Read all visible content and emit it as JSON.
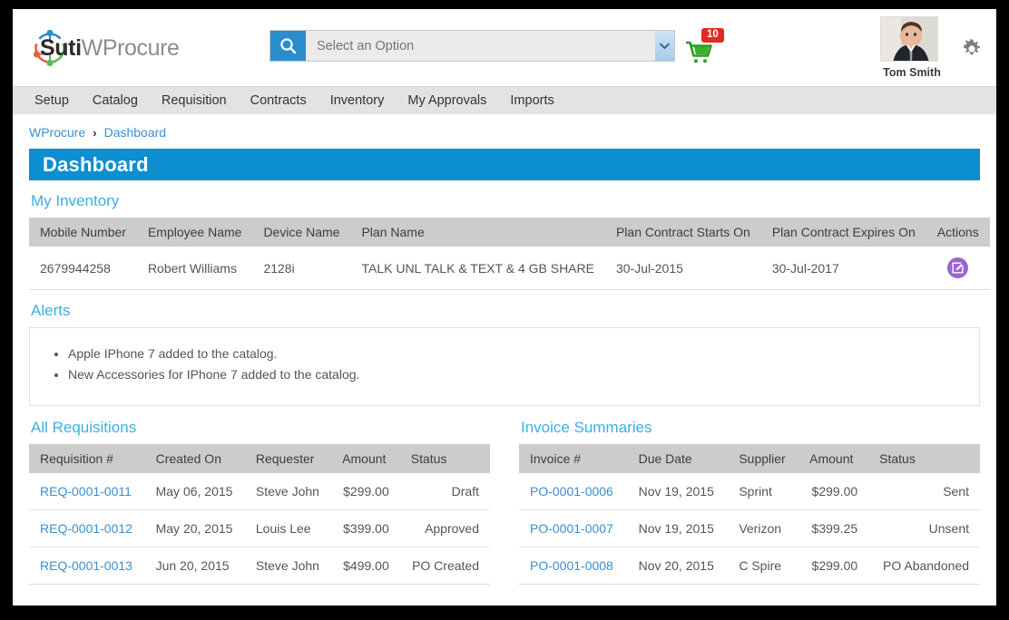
{
  "brand": {
    "name_bold": "Suti",
    "name_rest": "WProcure",
    "logo_colors": {
      "blue": "#2b8ccc",
      "orange": "#e8603c",
      "green": "#5cb85c"
    }
  },
  "header": {
    "search": {
      "placeholder": "Select an Option",
      "value": "",
      "icon": "search-icon",
      "dropdown_icon": "chevron-down-icon"
    },
    "cart": {
      "icon": "shopping-cart-icon",
      "badge_count": "10",
      "badge_color": "#e02b20"
    },
    "profile": {
      "name": "Tom Smith",
      "avatar_alt": "user-avatar"
    },
    "settings": {
      "icon": "gear-icon"
    }
  },
  "nav": {
    "items": [
      {
        "label": "Setup"
      },
      {
        "label": "Catalog"
      },
      {
        "label": "Requisition"
      },
      {
        "label": "Contracts"
      },
      {
        "label": "Inventory"
      },
      {
        "label": "My Approvals"
      },
      {
        "label": "Imports"
      }
    ]
  },
  "breadcrumb": {
    "root": "WProcure",
    "separator": "›",
    "current": "Dashboard"
  },
  "page": {
    "title": "Dashboard",
    "banner_color": "#0d8ed1"
  },
  "my_inventory": {
    "title": "My Inventory",
    "columns": [
      "Mobile Number",
      "Employee Name",
      "Device Name",
      "Plan Name",
      "Plan Contract Starts On",
      "Plan Contract Expires On",
      "Actions"
    ],
    "rows": [
      {
        "mobile_number": "2679944258",
        "employee_name": "Robert Williams",
        "device_name": "2128i",
        "plan_name": "TALK UNL TALK & TEXT & 4 GB SHARE",
        "starts_on": "30-Jul-2015",
        "expires_on": "30-Jul-2017",
        "action_icon": "edit-icon"
      }
    ]
  },
  "alerts": {
    "title": "Alerts",
    "items": [
      "Apple IPhone 7 added to the catalog.",
      "New Accessories for IPhone 7 added to the catalog."
    ]
  },
  "all_requisitions": {
    "title": "All Requisitions",
    "columns": [
      "Requisition #",
      "Created On",
      "Requester",
      "Amount",
      "Status"
    ],
    "rows": [
      {
        "requisition_no": "REQ-0001-0011",
        "created_on": "May 06, 2015",
        "requester": "Steve John",
        "amount": "$299.00",
        "status": "Draft",
        "status_color": "#e8251c"
      },
      {
        "requisition_no": "REQ-0001-0012",
        "created_on": "May 20, 2015",
        "requester": "Louis Lee",
        "amount": "$399.00",
        "status": "Approved",
        "status_color": "#e8251c"
      },
      {
        "requisition_no": "REQ-0001-0013",
        "created_on": "Jun 20, 2015",
        "requester": "Steve John",
        "amount": "$499.00",
        "status": "PO Created",
        "status_color": "#e8251c"
      }
    ]
  },
  "invoice_summaries": {
    "title": "Invoice Summaries",
    "columns": [
      "Invoice #",
      "Due Date",
      "Supplier",
      "Amount",
      "Status"
    ],
    "rows": [
      {
        "invoice_no": "PO-0001-0006",
        "due_date": "Nov 19, 2015",
        "supplier": "Sprint",
        "amount": "$299.00",
        "status": "Sent",
        "status_color": "#f0a21b"
      },
      {
        "invoice_no": "PO-0001-0007",
        "due_date": "Nov 19, 2015",
        "supplier": "Verizon",
        "amount": "$399.25",
        "status": "Unsent",
        "status_color": "#f0a21b"
      },
      {
        "invoice_no": "PO-0001-0008",
        "due_date": "Nov 20, 2015",
        "supplier": "C Spire",
        "amount": "$299.00",
        "status": "PO Abandoned",
        "status_color": "#f0a21b"
      }
    ]
  }
}
